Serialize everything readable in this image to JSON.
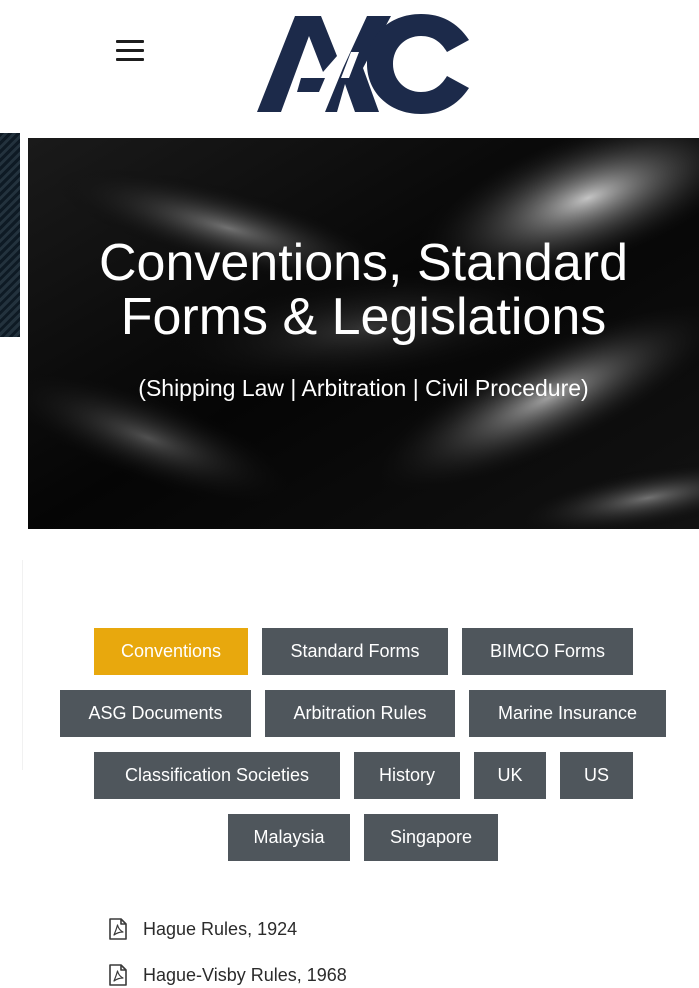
{
  "header": {
    "logo_text": "AKC"
  },
  "hero": {
    "title_line1": "Conventions, Standard",
    "title_line2": "Forms & Legislations",
    "subtitle": "(Shipping Law | Arbitration | Civil Procedure)"
  },
  "tabs": [
    {
      "label": "Conventions",
      "active": true
    },
    {
      "label": "Standard Forms",
      "active": false
    },
    {
      "label": "BIMCO Forms",
      "active": false
    },
    {
      "label": "ASG Documents",
      "active": false
    },
    {
      "label": "Arbitration Rules",
      "active": false
    },
    {
      "label": "Marine Insurance",
      "active": false
    },
    {
      "label": "Classification Societies",
      "active": false
    },
    {
      "label": "History",
      "active": false
    },
    {
      "label": "UK",
      "active": false
    },
    {
      "label": "US",
      "active": false
    },
    {
      "label": "Malaysia",
      "active": false
    },
    {
      "label": "Singapore",
      "active": false
    }
  ],
  "documents": [
    {
      "label": "Hague Rules, 1924",
      "icon": "pdf-file-icon"
    },
    {
      "label": "Hague-Visby Rules, 1968",
      "icon": "pdf-file-icon"
    }
  ],
  "colors": {
    "brand_navy": "#1c2a4a",
    "accent": "#e8a80d",
    "tab_gray": "#4f565c"
  }
}
